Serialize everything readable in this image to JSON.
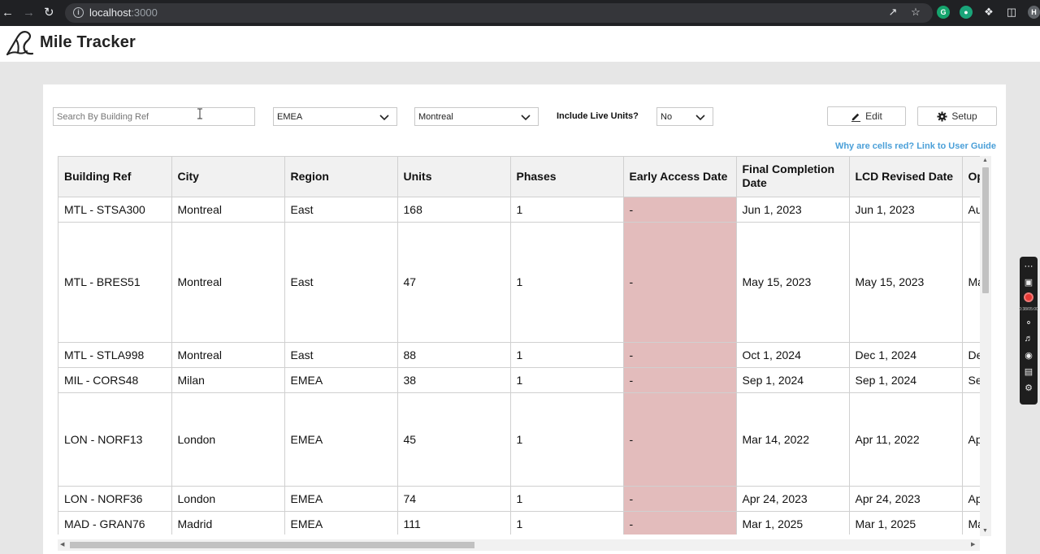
{
  "browser": {
    "url_host": "localhost",
    "url_port": ":3000",
    "profile_initial": "H"
  },
  "app": {
    "brand": "Mile Tracker"
  },
  "filters": {
    "search_placeholder": "Search By Building Ref",
    "region_value": "EMEA",
    "city_value": "Montreal",
    "include_live_label": "Include Live Units?",
    "include_live_value": "No",
    "edit_label": "Edit",
    "setup_label": "Setup",
    "guide_link": "Why are cells red? Link to User Guide"
  },
  "table": {
    "headers": [
      "Building Ref",
      "City",
      "Region",
      "Units",
      "Phases",
      "Early Access Date",
      "Final Completion Date",
      "LCD Revised Date",
      "Op Co"
    ],
    "rows": [
      [
        "MTL - STSA300",
        "Montreal",
        "East",
        "168",
        "1",
        "-",
        "Jun 1, 2023",
        "Jun 1, 2023",
        "Aug"
      ],
      [
        "MTL - BRES51",
        "Montreal",
        "East",
        "47",
        "1",
        "-",
        "May 15, 2023",
        "May 15, 2023",
        "Ma"
      ],
      [
        "MTL - STLA998",
        "Montreal",
        "East",
        "88",
        "1",
        "-",
        "Oct 1, 2024",
        "Dec 1, 2024",
        "De"
      ],
      [
        "MIL - CORS48",
        "Milan",
        "EMEA",
        "38",
        "1",
        "-",
        "Sep 1, 2024",
        "Sep 1, 2024",
        "Se"
      ],
      [
        "LON - NORF13",
        "London",
        "EMEA",
        "45",
        "1",
        "-",
        "Mar 14, 2022",
        "Apr 11, 2022",
        "Ap"
      ],
      [
        "LON - NORF36",
        "London",
        "EMEA",
        "74",
        "1",
        "-",
        "Apr 24, 2023",
        "Apr 24, 2023",
        "Ap"
      ],
      [
        "MAD - GRAN76",
        "Madrid",
        "EMEA",
        "111",
        "1",
        "-",
        "Mar 1, 2025",
        "Mar 1, 2025",
        "Ma"
      ]
    ]
  },
  "colors": {
    "red_cell": "#e3bcbc",
    "link": "#4a9fd8"
  },
  "recorder": {
    "time": "0:38/05:00"
  }
}
